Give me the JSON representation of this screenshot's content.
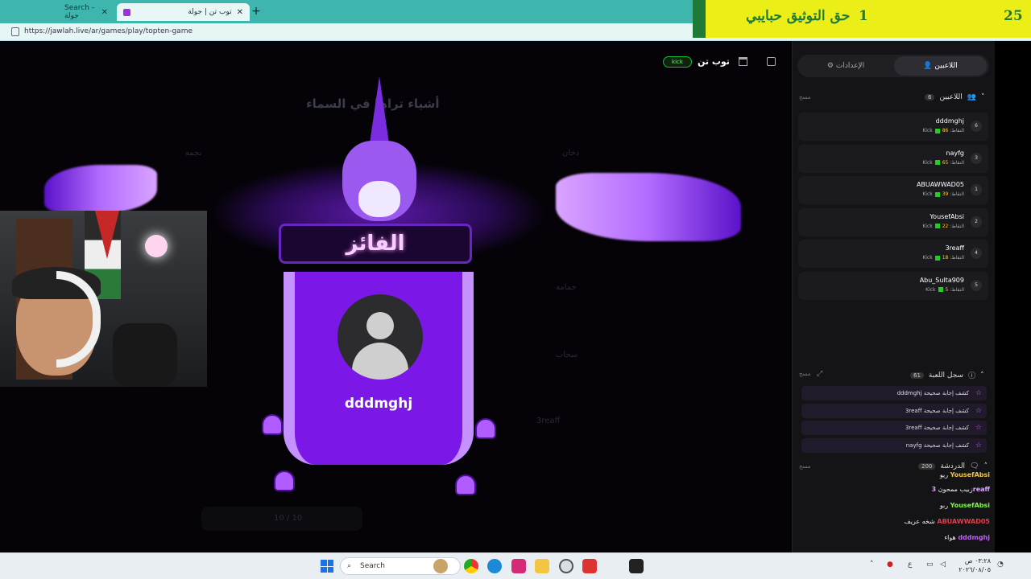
{
  "browser": {
    "tabs": [
      {
        "label": "Search - جولة"
      },
      {
        "label": "توب تن | جولة"
      }
    ],
    "url": "https://jawlah.live/ar/games/play/topten-game"
  },
  "banner": {
    "text": "حق التوثيق حبايبي",
    "num1": "1",
    "num2": "25"
  },
  "game": {
    "title": "توب تن",
    "kick": "kick",
    "question": "أشياء تراها في السماء",
    "ghost_labels": [
      "نجمة",
      "دخان",
      "حمامة",
      "سحاب",
      "3reaff"
    ],
    "progress": "10 / 10",
    "winner": {
      "title": "الفائز",
      "name": "dddmghj"
    }
  },
  "panel": {
    "tab_players": "اللاعبين",
    "tab_settings": "الإعدادات",
    "players_header": "اللاعبين",
    "players_count": "6",
    "clear_label": "مسح",
    "points_label": "النقاط",
    "kick_label": "Kick",
    "players": [
      {
        "name": "dddmghj",
        "points": "86",
        "rank": "6"
      },
      {
        "name": "nayfg",
        "points": "65",
        "rank": "3"
      },
      {
        "name": "ABUAWWAD05",
        "points": "39",
        "rank": "1"
      },
      {
        "name": "YousefAbsi",
        "points": "22",
        "rank": "2"
      },
      {
        "name": "3reaff",
        "points": "18",
        "rank": "4"
      },
      {
        "name": "Abu_Sulta909",
        "points": "5",
        "rank": "5"
      }
    ],
    "log_header": "سجل اللعبة",
    "log_count": "61",
    "log": [
      "dddmghj كشف إجابة صحيحة",
      "3reaff كشف إجابة صحيحة",
      "3reaff كشف إجابة صحيحة",
      "nayfg كشف إجابة صحيحة"
    ],
    "chat_header": "الدردشة",
    "chat_count": "200",
    "chat": [
      {
        "user": "YousefAbsi",
        "text": "ريو",
        "color": "#f5c542"
      },
      {
        "user": "3reaff",
        "text": "زبيب ممحون",
        "color": "#d7a6ff"
      },
      {
        "user": "YousefAbsi",
        "text": "ربو",
        "color": "#7cfc3c"
      },
      {
        "user": "ABUAWWAD05",
        "text": "شخه عريف",
        "color": "#e63b4a"
      },
      {
        "user": "dddmghj",
        "text": "هواء",
        "color": "#c55cff"
      }
    ]
  },
  "taskbar": {
    "search": "Search",
    "time": "٠٣:٢٨ ص",
    "date": "٢٠٢٦/٠٨/٠٥",
    "lang": "ع"
  }
}
